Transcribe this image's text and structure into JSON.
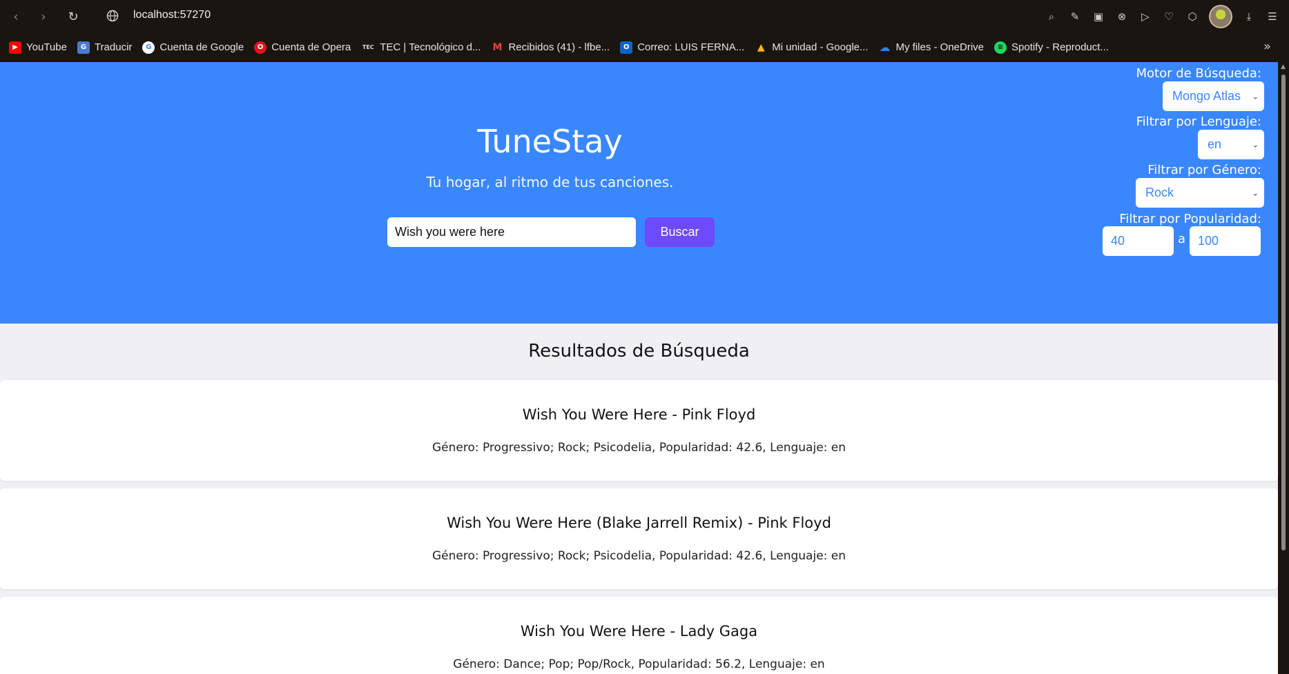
{
  "browser": {
    "url": "localhost:57270",
    "bookmarks": [
      {
        "label": "YouTube",
        "icon": "youtube-icon",
        "color": "#ff0000"
      },
      {
        "label": "Traducir",
        "icon": "translate-icon",
        "color": "#4a7bd0"
      },
      {
        "label": "Cuenta de Google",
        "icon": "google-icon",
        "color": "#ffffff"
      },
      {
        "label": "Cuenta de Opera",
        "icon": "opera-icon",
        "color": "#e0141e"
      },
      {
        "label": "TEC | Tecnológico d...",
        "icon": "tec-icon",
        "color": "#1a1510"
      },
      {
        "label": "Recibidos (41) - lfbe...",
        "icon": "gmail-icon",
        "color": "#ea4335"
      },
      {
        "label": "Correo: LUIS FERNA...",
        "icon": "outlook-icon",
        "color": "#0a64c8"
      },
      {
        "label": "Mi unidad - Google...",
        "icon": "drive-icon",
        "color": "#1fa463"
      },
      {
        "label": "My files - OneDrive",
        "icon": "onedrive-icon",
        "color": "#1e88e5"
      },
      {
        "label": "Spotify - Reproduct...",
        "icon": "spotify-icon",
        "color": "#1ed760"
      }
    ]
  },
  "hero": {
    "brand": "TuneStay",
    "tagline": "Tu hogar, al ritmo de tus canciones.",
    "search_value": "Wish you were here",
    "search_button": "Buscar"
  },
  "filters": {
    "engine_label": "Motor de Búsqueda:",
    "engine_value": "Mongo Atlas",
    "language_label": "Filtrar por Lenguaje:",
    "language_value": "en",
    "genre_label": "Filtrar por Género:",
    "genre_value": "Rock",
    "popularity_label": "Filtrar por Popularidad:",
    "popularity_min": "40",
    "popularity_sep": "a",
    "popularity_max": "100"
  },
  "results": {
    "title": "Resultados de Búsqueda",
    "items": [
      {
        "title": "Wish You Were Here - Pink Floyd",
        "meta": "Género: Progressivo; Rock; Psicodelia, Popularidad: 42.6, Lenguaje: en"
      },
      {
        "title": "Wish You Were Here (Blake Jarrell Remix) - Pink Floyd",
        "meta": "Género: Progressivo; Rock; Psicodelia, Popularidad: 42.6, Lenguaje: en"
      },
      {
        "title": "Wish You Were Here - Lady Gaga",
        "meta": "Género: Dance; Pop; Pop/Rock, Popularidad: 56.2, Lenguaje: en"
      }
    ]
  },
  "colors": {
    "hero_bg": "#3a87fd",
    "button_bg": "#6b4bfb",
    "page_bg": "#f0f0f4"
  }
}
